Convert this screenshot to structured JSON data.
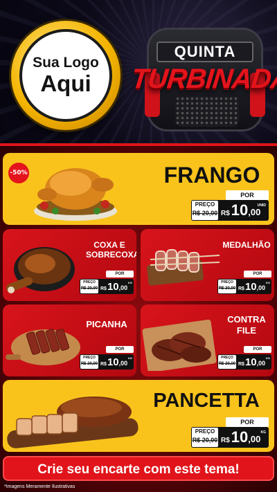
{
  "header": {
    "logo": {
      "line1": "Sua Logo",
      "line2": "Aqui"
    },
    "title": {
      "line1": "QUINTA",
      "line2": "TURBINADA"
    }
  },
  "products": [
    {
      "name": "FRANGO",
      "discount": "-50%",
      "price_label": "PREÇO",
      "old_price": "R$ 20,00",
      "per_label": "POR",
      "currency": "R$",
      "price_int": "10",
      "price_dec": ",00",
      "unit": "UNID"
    },
    {
      "name": "COXA E SOBRECOXA",
      "price_label": "PREÇO",
      "old_price": "R$ 20,00",
      "per_label": "POR",
      "currency": "R$",
      "price_int": "10",
      "price_dec": ",00",
      "unit": "KG"
    },
    {
      "name": "MEDALHÃO",
      "price_label": "PREÇO",
      "old_price": "R$ 20,00",
      "per_label": "POR",
      "currency": "R$",
      "price_int": "10",
      "price_dec": ",00",
      "unit": "KG"
    },
    {
      "name": "PICANHA",
      "price_label": "PREÇO",
      "old_price": "R$ 20,00",
      "per_label": "POR",
      "currency": "R$",
      "price_int": "10",
      "price_dec": ",00",
      "unit": "KG"
    },
    {
      "name": "CONTRA FILE",
      "price_label": "PREÇO",
      "old_price": "R$ 20,00",
      "per_label": "POR",
      "currency": "R$",
      "price_int": "10",
      "price_dec": ",00",
      "unit": "KG"
    },
    {
      "name": "PANCETTA",
      "price_label": "PREÇO",
      "old_price": "R$ 20,00",
      "per_label": "POR",
      "currency": "R$",
      "price_int": "10",
      "price_dec": ",00",
      "unit": "KG"
    }
  ],
  "cta": "Crie seu encarte com este tema!",
  "footnote": "*Imagens Meramente Ilustrativas",
  "colors": {
    "brand_red": "#e0141a",
    "brand_yellow": "#f9c31c",
    "dark": "#111111"
  }
}
